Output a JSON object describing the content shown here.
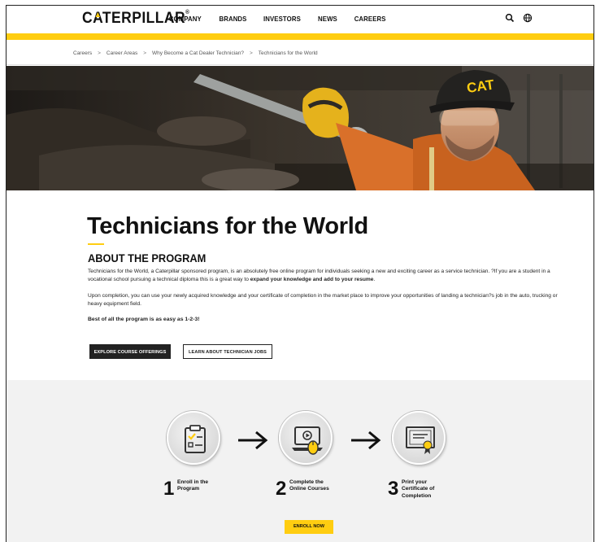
{
  "header": {
    "logo_text": "CATERPILLAR",
    "logo_mark": "®",
    "nav": [
      "COMPANY",
      "BRANDS",
      "INVESTORS",
      "NEWS",
      "CAREERS"
    ],
    "icons": [
      "search-icon",
      "globe-icon"
    ],
    "accent_color": "#ffcd11"
  },
  "breadcrumb": [
    "Careers",
    "Career Areas",
    "Why Become a Cat Dealer Technician?",
    "Technicians for the World"
  ],
  "breadcrumb_separator": ">",
  "hero": {
    "cap_logo": "CAT"
  },
  "main": {
    "title": "Technicians for the World",
    "subtitle": "ABOUT THE PROGRAM",
    "p1_a": "Technicians for the World, a Caterpillar sponsored program, is an absolutely free online program for individuals seeking a new and exciting career as a service technician. ?If you are a student in a vocational school pursuing a technical diploma this is a great way to ",
    "p1_b": "expand your knowledge and add to your resume",
    "p1_c": ".",
    "p2": "Upon completion, you can use your newly acquired knowledge and your certificate of completion in the market place to improve your opportunities of landing a technician?s job in the auto, trucking or heavy equipment field.",
    "p3": "Best of all the program is as easy as 1-2-3!",
    "btn_explore": "EXPLORE COURSE OFFERINGS",
    "btn_learn": "LEARN ABOUT TECHNICIAN JOBS"
  },
  "steps": [
    {
      "num": "1",
      "l1": "Enroll in the",
      "l2": "Program",
      "l3": "",
      "icon": "clipboard-checklist-icon"
    },
    {
      "num": "2",
      "l1": "Complete the",
      "l2": "Online Courses",
      "l3": "",
      "icon": "laptop-mouse-icon"
    },
    {
      "num": "3",
      "l1": "Print your",
      "l2": "Certificate of",
      "l3": "Completion",
      "icon": "certificate-icon"
    }
  ],
  "enroll_label": "ENROLL NOW"
}
